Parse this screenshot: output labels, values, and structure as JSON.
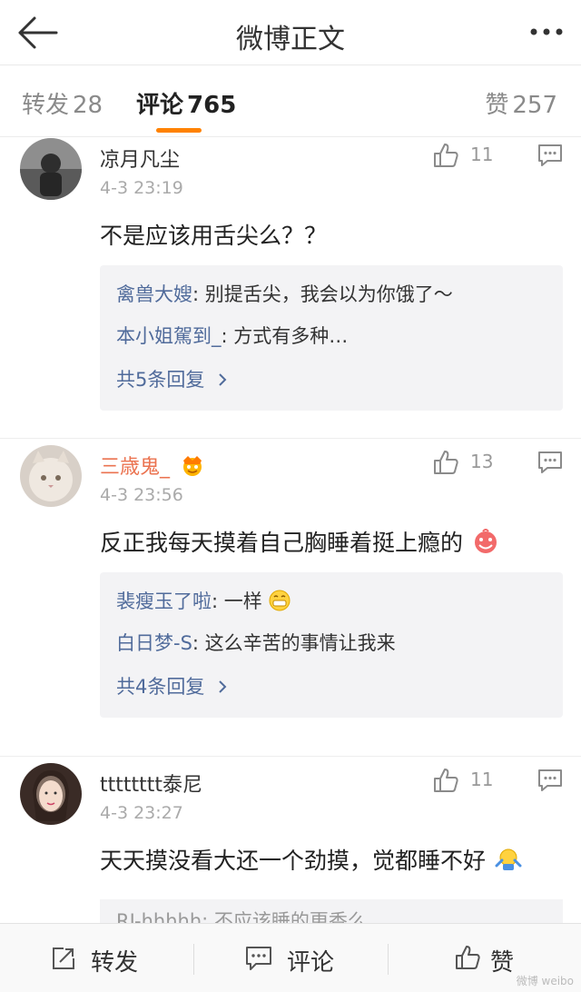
{
  "header": {
    "title": "微博正文"
  },
  "tabs": {
    "repost": {
      "label": "转发",
      "count": "28"
    },
    "comment": {
      "label": "评论",
      "count": "765"
    },
    "like": {
      "label": "赞",
      "count": "257"
    }
  },
  "comments": [
    {
      "user": "凉月凡尘",
      "time": "4-3 23:19",
      "likes": "11",
      "text": "不是应该用舌尖么？？",
      "replies": [
        {
          "name": "禽兽大嫂",
          "text": ": 别提舌尖，我会以为你饿了～"
        },
        {
          "name": "本小姐駕到_",
          "text": ": 方式有多种…"
        }
      ],
      "more": "共5条回复"
    },
    {
      "user": "三歳鬼_",
      "time": "4-3 23:56",
      "likes": "13",
      "text": "反正我每天摸着自己胸睡着挺上瘾的",
      "replies": [
        {
          "name": "裴瘦玉了啦",
          "text": ": 一样"
        },
        {
          "name": "白日梦-S",
          "text": ": 这么辛苦的事情让我来"
        }
      ],
      "more": "共4条回复"
    },
    {
      "user": "tttttttt泰尼",
      "time": "4-3 23:27",
      "likes": "11",
      "text": "天天摸没看大还一个劲摸，觉都睡不好",
      "partial_reply": "RJ-hhhhh: 不应该睡的更香么"
    }
  ],
  "bottom": {
    "repost": "转发",
    "comment": "评论",
    "like": "赞"
  },
  "watermark": "微博 weibo",
  "icons": [
    "back-arrow-icon",
    "more-dots-icon",
    "thumb-up-icon",
    "reply-comment-icon",
    "chevron-right-icon",
    "share-icon",
    "comment-icon"
  ],
  "colors": {
    "accent": "#ff8200",
    "link": "#506b9b",
    "username_highlight": "#eb7350"
  }
}
